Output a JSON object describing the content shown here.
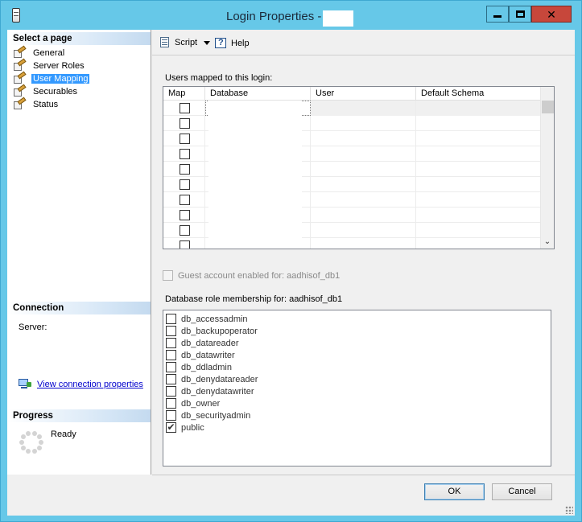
{
  "window": {
    "title": "Login Properties -"
  },
  "left_pane": {
    "select_page_header": "Select a page",
    "pages": [
      {
        "label": "General",
        "selected": false
      },
      {
        "label": "Server Roles",
        "selected": false
      },
      {
        "label": "User Mapping",
        "selected": true
      },
      {
        "label": "Securables",
        "selected": false
      },
      {
        "label": "Status",
        "selected": false
      }
    ],
    "connection_header": "Connection",
    "server_label": "Server:",
    "connection_link": "View connection properties",
    "progress_header": "Progress",
    "progress_status": "Ready"
  },
  "toolbar": {
    "script_label": "Script",
    "help_label": "Help"
  },
  "users_mapped": {
    "label": "Users mapped to this login:",
    "columns": [
      "Map",
      "Database",
      "User",
      "Default Schema"
    ],
    "rows": [
      {
        "map": false
      },
      {
        "map": false
      },
      {
        "map": false
      },
      {
        "map": false
      },
      {
        "map": false
      },
      {
        "map": false
      },
      {
        "map": false
      },
      {
        "map": false
      },
      {
        "map": false
      },
      {
        "map": false
      }
    ]
  },
  "guest_account": {
    "label": "Guest account enabled for: aadhisof_db1",
    "checked": false,
    "enabled": false
  },
  "role_membership": {
    "label": "Database role membership for: aadhisof_db1",
    "roles": [
      {
        "name": "db_accessadmin",
        "checked": false
      },
      {
        "name": "db_backupoperator",
        "checked": false
      },
      {
        "name": "db_datareader",
        "checked": false
      },
      {
        "name": "db_datawriter",
        "checked": false
      },
      {
        "name": "db_ddladmin",
        "checked": false
      },
      {
        "name": "db_denydatareader",
        "checked": false
      },
      {
        "name": "db_denydatawriter",
        "checked": false
      },
      {
        "name": "db_owner",
        "checked": false
      },
      {
        "name": "db_securityadmin",
        "checked": false
      },
      {
        "name": "public",
        "checked": true
      }
    ]
  },
  "buttons": {
    "ok": "OK",
    "cancel": "Cancel"
  }
}
